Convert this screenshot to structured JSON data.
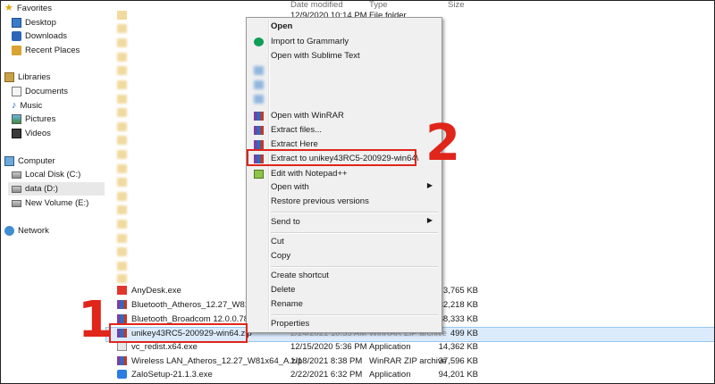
{
  "nav": {
    "favorites": "Favorites",
    "desktop": "Desktop",
    "downloads": "Downloads",
    "recent_places": "Recent Places",
    "libraries": "Libraries",
    "documents": "Documents",
    "music": "Music",
    "pictures": "Pictures",
    "videos": "Videos",
    "computer": "Computer",
    "local_disk": "Local Disk (C:)",
    "data_d": "data (D:)",
    "new_volume": "New Volume (E:)",
    "network": "Network"
  },
  "columns": {
    "date_modified": "Date modified",
    "type": "Type",
    "size": "Size"
  },
  "first_row": {
    "date": "12/9/2020 10:14 PM",
    "type": "File folder"
  },
  "files": [
    {
      "name": "AnyDesk.exe",
      "date": "",
      "type": "",
      "size": "3,765 KB"
    },
    {
      "name": "Bluetooth_Atheros_12.27_W81x64",
      "date": "",
      "type": "",
      "size": "232,218 KB"
    },
    {
      "name": "Bluetooth_Broadcom 12.0.0.7850",
      "date": "",
      "type": "",
      "size": "188,333 KB"
    },
    {
      "name": "unikey43RC5-200929-win64.zip",
      "date": "2/24/2021 10:55 AM",
      "type": "WinRAR ZIP archive",
      "size": "499 KB"
    },
    {
      "name": "vc_redist.x64.exe",
      "date": "12/15/2020 5:36 PM",
      "type": "Application",
      "size": "14,362 KB"
    },
    {
      "name": "Wireless LAN_Atheros_12.27_W81x64_A.zip",
      "date": "1/18/2021 8:38 PM",
      "type": "WinRAR ZIP archive",
      "size": "37,596 KB"
    },
    {
      "name": "ZaloSetup-21.1.3.exe",
      "date": "2/22/2021 6:32 PM",
      "type": "Application",
      "size": "94,201 KB"
    }
  ],
  "menu": {
    "open": "Open",
    "import_grammarly": "Import to Grammarly",
    "open_sublime": "Open with Sublime Text",
    "open_winrar": "Open with WinRAR",
    "extract_files": "Extract files...",
    "extract_here": "Extract Here",
    "extract_to": "Extract to unikey43RC5-200929-win64\\",
    "edit_notepad": "Edit with Notepad++",
    "open_with": "Open with",
    "restore": "Restore previous versions",
    "send_to": "Send to",
    "cut": "Cut",
    "copy": "Copy",
    "create_shortcut": "Create shortcut",
    "delete": "Delete",
    "rename": "Rename",
    "properties": "Properties"
  },
  "annotations": {
    "step1": "1",
    "step2": "2"
  },
  "colors": {
    "highlight": "#e0251b",
    "selection": "#dcebfc"
  }
}
